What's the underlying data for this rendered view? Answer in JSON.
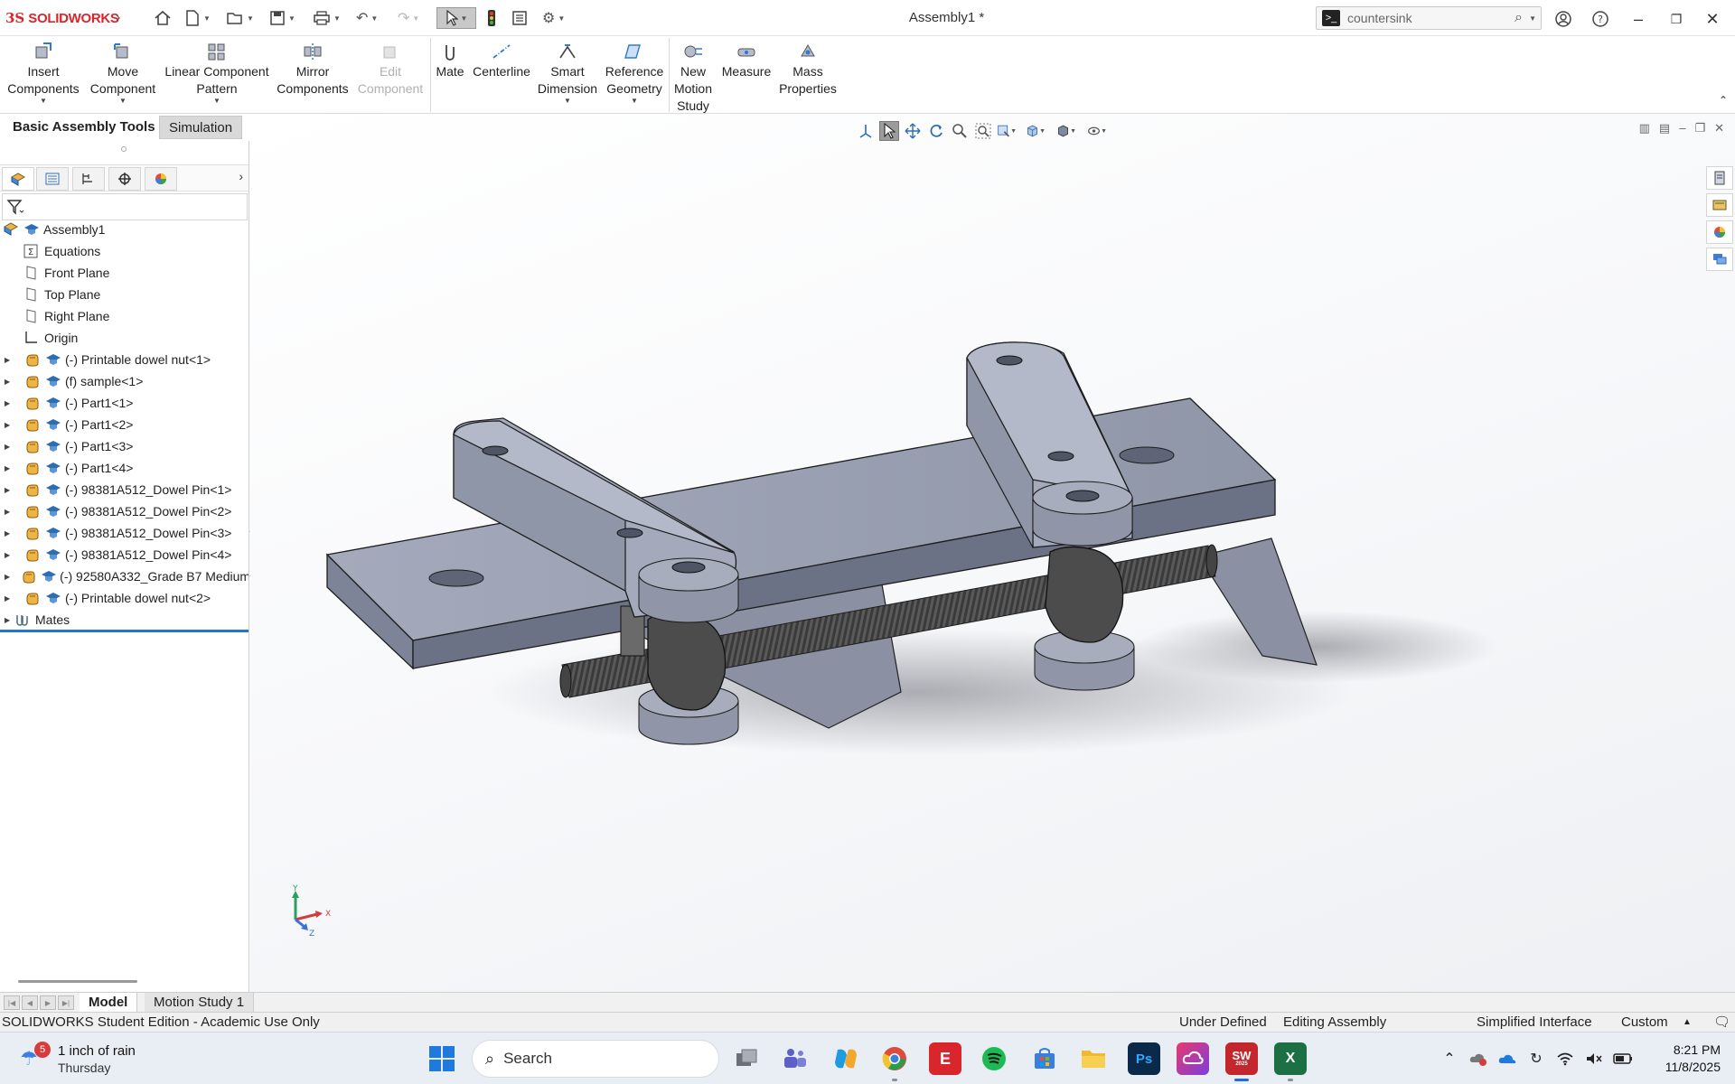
{
  "app": {
    "logo_ds": "3S",
    "logo_text": "SOLIDWORKS",
    "window_title": "Assembly1 *"
  },
  "search": {
    "value": "countersink",
    "icon": "terminal-icon"
  },
  "ribbon": {
    "insert_components": [
      "Insert",
      "Components"
    ],
    "move_component": [
      "Move",
      "Component"
    ],
    "linear_pattern": [
      "Linear Component",
      "Pattern"
    ],
    "mirror_components": [
      "Mirror",
      "Components"
    ],
    "edit_component": [
      "Edit",
      "Component"
    ],
    "mate": "Mate",
    "centerline": "Centerline",
    "smart_dimension": [
      "Smart",
      "Dimension"
    ],
    "reference_geometry": [
      "Reference",
      "Geometry"
    ],
    "new_motion_study": [
      "New",
      "Motion",
      "Study"
    ],
    "measure": "Measure",
    "mass_properties": [
      "Mass",
      "Properties"
    ]
  },
  "command_tabs": {
    "basic": "Basic Assembly Tools",
    "simulation": "Simulation"
  },
  "tree": {
    "root": "Assembly1",
    "items": [
      {
        "label": "Equations",
        "type": "equations"
      },
      {
        "label": "Front Plane",
        "type": "plane"
      },
      {
        "label": "Top Plane",
        "type": "plane"
      },
      {
        "label": "Right Plane",
        "type": "plane"
      },
      {
        "label": "Origin",
        "type": "origin"
      },
      {
        "label": "(-) Printable dowel nut<1>",
        "type": "part"
      },
      {
        "label": "(f) sample<1>",
        "type": "part"
      },
      {
        "label": "(-) Part1<1>",
        "type": "part"
      },
      {
        "label": "(-) Part1<2>",
        "type": "part"
      },
      {
        "label": "(-) Part1<3>",
        "type": "part"
      },
      {
        "label": "(-) Part1<4>",
        "type": "part"
      },
      {
        "label": "(-) 98381A512_Dowel Pin<1>",
        "type": "part"
      },
      {
        "label": "(-) 98381A512_Dowel Pin<2>",
        "type": "part"
      },
      {
        "label": "(-) 98381A512_Dowel Pin<3>",
        "type": "part"
      },
      {
        "label": "(-) 98381A512_Dowel Pin<4>",
        "type": "part"
      },
      {
        "label": "(-) 92580A332_Grade B7 Medium",
        "type": "part"
      },
      {
        "label": "(-) Printable dowel nut<2>",
        "type": "part"
      },
      {
        "label": "Mates",
        "type": "mates"
      }
    ]
  },
  "triad": {
    "x": "X",
    "y": "Y",
    "z": "Z"
  },
  "bottom_tabs": {
    "model": "Model",
    "motion": "Motion Study 1"
  },
  "status": {
    "edition": "SOLIDWORKS Student Edition - Academic Use Only",
    "definition": "Under Defined",
    "mode": "Editing Assembly",
    "interface": "Simplified Interface",
    "units": "Custom"
  },
  "taskbar": {
    "weather_badge": "5",
    "weather_line1": "1 inch of rain",
    "weather_line2": "Thursday",
    "search_label": "Search",
    "time": "8:21 PM",
    "date": "11/8/2025",
    "solidworks_badge": "2025"
  },
  "colors": {
    "brand": "#d8262a",
    "accent": "#1e78d2",
    "model_face": "#9da3b4",
    "model_dark": "#4c4c4c"
  }
}
